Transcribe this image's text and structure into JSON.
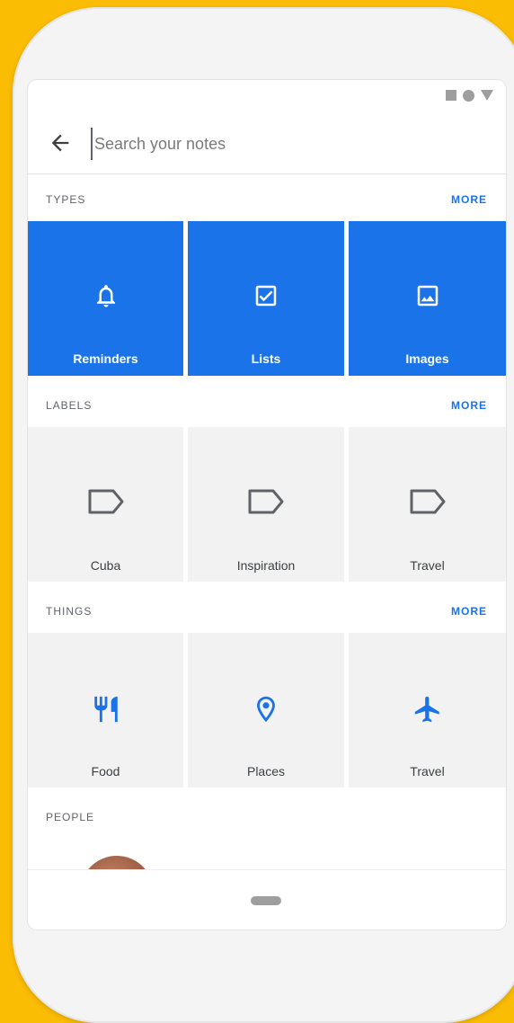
{
  "search": {
    "placeholder": "Search your notes"
  },
  "sections": {
    "types": {
      "title": "TYPES",
      "more": "MORE"
    },
    "labels": {
      "title": "LABELS",
      "more": "MORE"
    },
    "things": {
      "title": "THINGS",
      "more": "MORE"
    },
    "people": {
      "title": "PEOPLE"
    }
  },
  "types": [
    {
      "label": "Reminders",
      "icon": "bell-icon"
    },
    {
      "label": "Lists",
      "icon": "checkbox-icon"
    },
    {
      "label": "Images",
      "icon": "image-icon"
    }
  ],
  "labels": [
    {
      "label": "Cuba",
      "icon": "label-tag-icon"
    },
    {
      "label": "Inspiration",
      "icon": "label-tag-icon"
    },
    {
      "label": "Travel",
      "icon": "label-tag-icon"
    }
  ],
  "things": [
    {
      "label": "Food",
      "icon": "restaurant-icon"
    },
    {
      "label": "Places",
      "icon": "location-pin-icon"
    },
    {
      "label": "Travel",
      "icon": "airplane-icon"
    }
  ],
  "colors": {
    "accent": "#1a73e8",
    "background": "#FBBC04",
    "tile_grey": "#f2f2f2"
  }
}
